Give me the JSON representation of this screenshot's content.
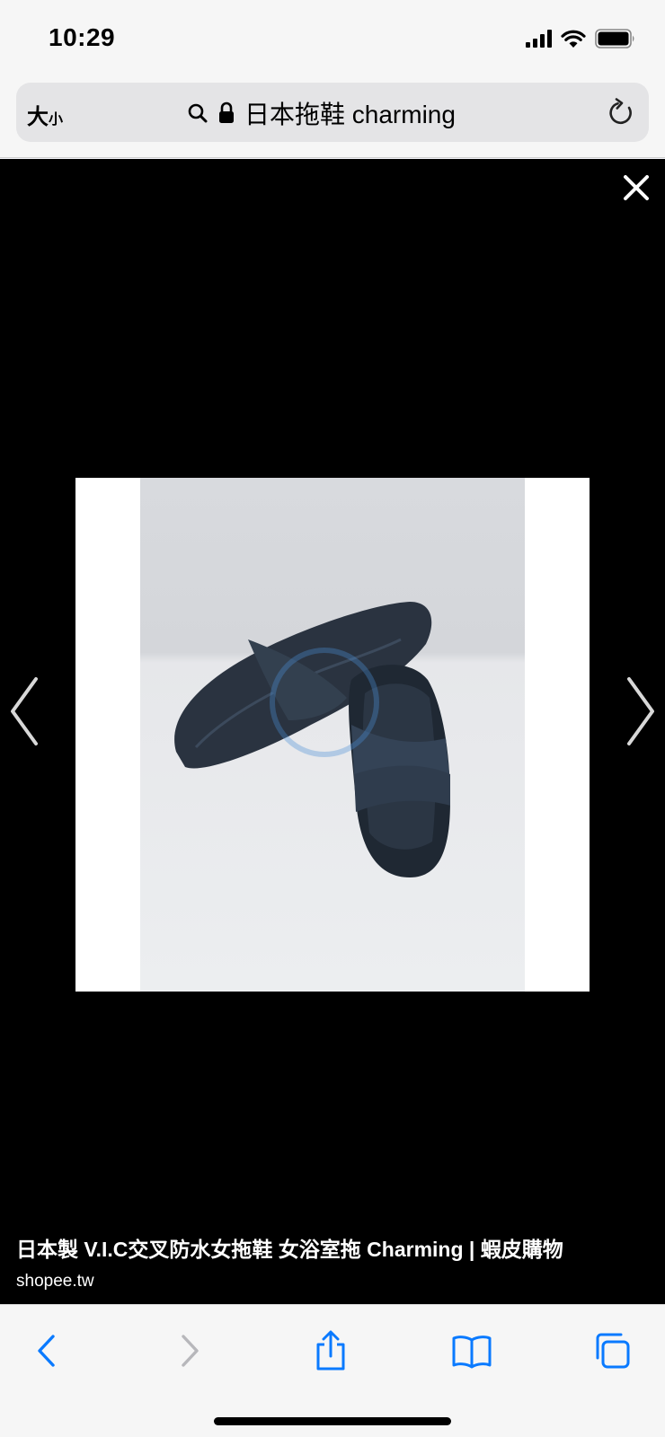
{
  "status_bar": {
    "time": "10:29",
    "icons": [
      "cellular-signal-icon",
      "wifi-icon",
      "battery-icon"
    ]
  },
  "address_bar": {
    "text_size_label_big": "大",
    "text_size_label_small": "小",
    "url_text": "日本拖鞋 charming",
    "icons": [
      "search-icon",
      "lock-icon",
      "reload-icon"
    ]
  },
  "viewer": {
    "background_color": "#000000",
    "image_subject": "dark navy cross-strap slide sandals on white backdrop",
    "caption_title": "日本製 V.I.C交叉防水女拖鞋 女浴室拖 Charming | 蝦皮購物",
    "caption_source": "shopee.tw",
    "icons": [
      "close-icon",
      "chevron-left-icon",
      "chevron-right-icon"
    ]
  },
  "bottom_toolbar": {
    "accent_color": "#0a7aff",
    "disabled_color": "#b7b7bb",
    "buttons": [
      "back-icon",
      "forward-icon",
      "share-icon",
      "bookmarks-icon",
      "tabs-icon"
    ]
  }
}
